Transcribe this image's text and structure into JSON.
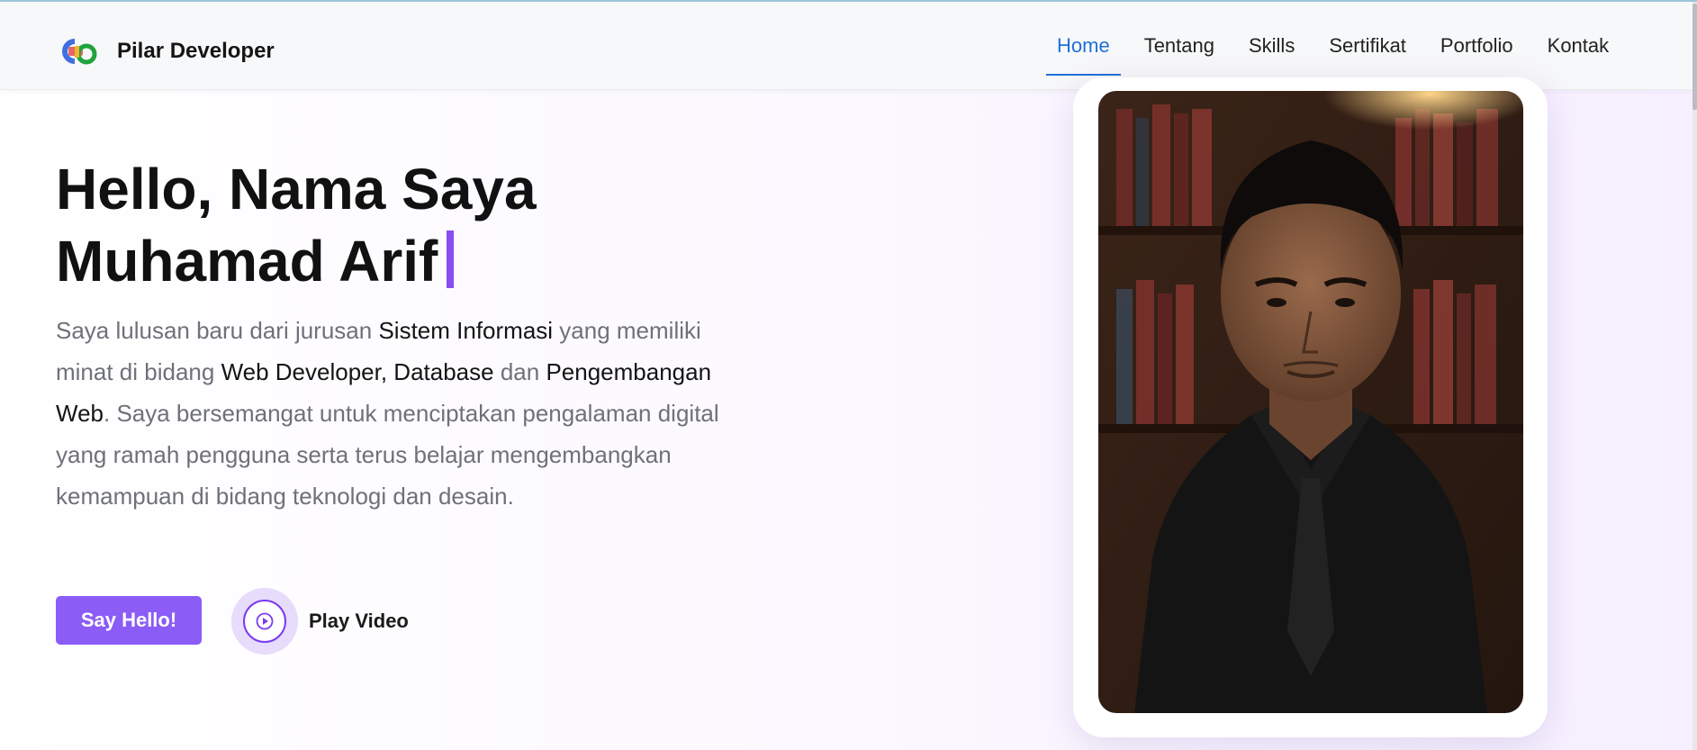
{
  "brand": {
    "name": "Pilar Developer",
    "logo_icon": "brand-logo-icon"
  },
  "nav": {
    "items": [
      {
        "label": "Home",
        "active": true
      },
      {
        "label": "Tentang",
        "active": false
      },
      {
        "label": "Skills",
        "active": false
      },
      {
        "label": "Sertifikat",
        "active": false
      },
      {
        "label": "Portfolio",
        "active": false
      },
      {
        "label": "Kontak",
        "active": false
      }
    ],
    "active_color": "#1f70d9"
  },
  "hero": {
    "title_line1": "Hello, Nama Saya",
    "title_line2": "Muhamad Arif",
    "desc": {
      "p1": "Saya lulusan baru dari jurusan ",
      "h1": "Sistem Informasi",
      "p2": " yang memiliki minat di bidang ",
      "h2": "Web Developer, Database",
      "p3": " dan ",
      "h3": "Pengembangan Web",
      "p4": ". Saya bersemangat untuk menciptakan pengalaman digital yang ramah pengguna serta terus belajar mengembangkan kemampuan di bidang teknologi dan desain."
    },
    "cta_label": "Say Hello!",
    "play_label": "Play Video",
    "accent_color": "#8b5cf6"
  },
  "photo": {
    "subject": "portrait-photo"
  }
}
